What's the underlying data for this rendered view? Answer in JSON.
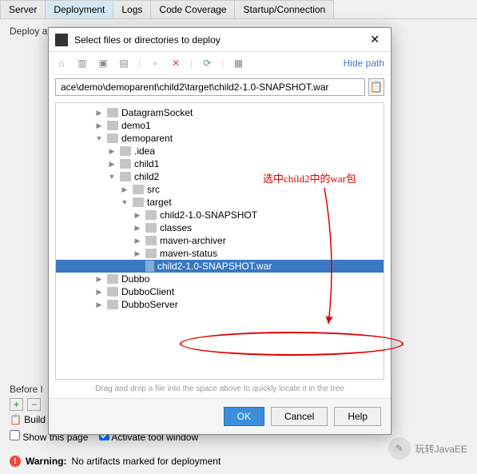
{
  "tabs": {
    "server": "Server",
    "deployment": "Deployment",
    "logs": "Logs",
    "coverage": "Code Coverage",
    "startup": "Startup/Connection"
  },
  "deploy_label": "Deploy at the server startup",
  "before": {
    "label": "Before l",
    "build": "Build",
    "show": "Show this page",
    "activate": "Activate tool window"
  },
  "warning": {
    "label": "Warning:",
    "text": "No artifacts marked for deployment"
  },
  "brand": "玩转JavaEE",
  "dialog": {
    "title": "Select files or directories to deploy",
    "hide_path": "Hide path",
    "path": "ace\\demo\\demoparent\\child2\\target\\child2-1.0-SNAPSHOT.war",
    "hint": "Drag and drop a file into the space above to quickly locate it in the tree",
    "ok": "OK",
    "cancel": "Cancel",
    "help": "Help"
  },
  "tree": [
    {
      "indent": 3,
      "arrow": "right",
      "type": "folder",
      "label": "DatagramSocket"
    },
    {
      "indent": 3,
      "arrow": "right",
      "type": "folder",
      "label": "demo1"
    },
    {
      "indent": 3,
      "arrow": "down",
      "type": "folder",
      "label": "demoparent"
    },
    {
      "indent": 4,
      "arrow": "right",
      "type": "folder",
      "label": ".idea"
    },
    {
      "indent": 4,
      "arrow": "right",
      "type": "folder",
      "label": "child1"
    },
    {
      "indent": 4,
      "arrow": "down",
      "type": "folder",
      "label": "child2"
    },
    {
      "indent": 5,
      "arrow": "right",
      "type": "folder",
      "label": "src"
    },
    {
      "indent": 5,
      "arrow": "down",
      "type": "folder",
      "label": "target"
    },
    {
      "indent": 6,
      "arrow": "right",
      "type": "folder",
      "label": "child2-1.0-SNAPSHOT"
    },
    {
      "indent": 6,
      "arrow": "right",
      "type": "folder",
      "label": "classes"
    },
    {
      "indent": 6,
      "arrow": "right",
      "type": "folder",
      "label": "maven-archiver"
    },
    {
      "indent": 6,
      "arrow": "right",
      "type": "folder",
      "label": "maven-status"
    },
    {
      "indent": 6,
      "arrow": "none",
      "type": "file",
      "label": "child2-1.0-SNAPSHOT.war",
      "selected": true
    },
    {
      "indent": 3,
      "arrow": "right",
      "type": "folder",
      "label": "Dubbo"
    },
    {
      "indent": 3,
      "arrow": "right",
      "type": "folder",
      "label": "DubboClient"
    },
    {
      "indent": 3,
      "arrow": "right",
      "type": "folder",
      "label": "DubboServer"
    }
  ],
  "annotation": "选中child2中的war包"
}
